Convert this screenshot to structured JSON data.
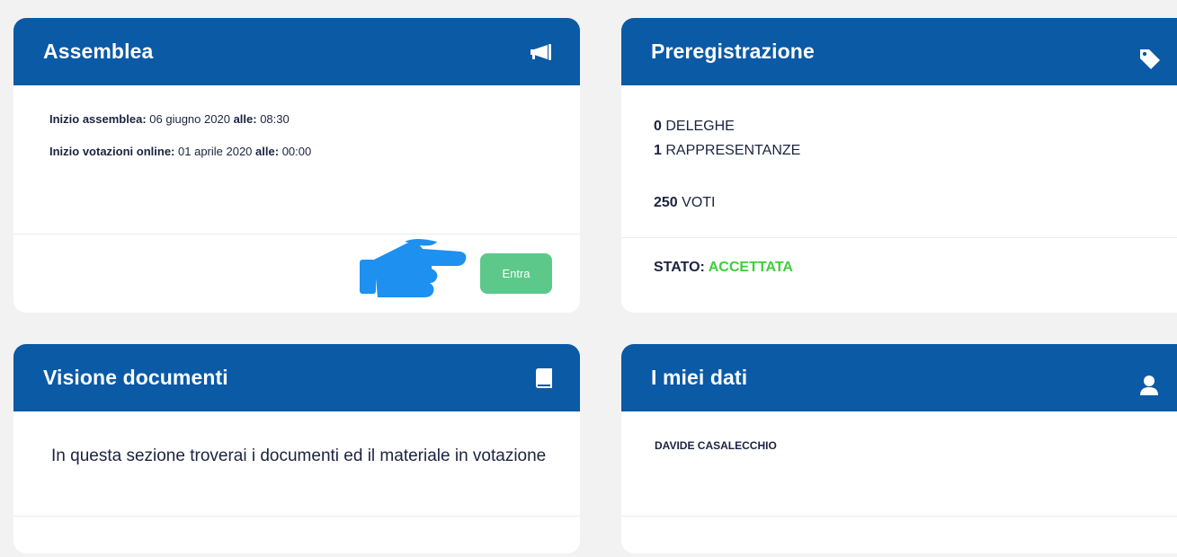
{
  "colors": {
    "header": "#0a5aa6",
    "button": "#5cc98a",
    "stato_ok": "#3ecf3a",
    "hand": "#1e90f0"
  },
  "assemblea": {
    "title": "Assemblea",
    "icon": "megaphone-icon",
    "inizio_label": "Inizio assemblea:",
    "inizio_date": "06 giugno 2020",
    "alle_label": "alle:",
    "inizio_time": "08:30",
    "votazioni_label": "Inizio votazioni online:",
    "votazioni_date": "01 aprile 2020",
    "votazioni_time": "00:00",
    "button": "Entra",
    "pointer_icon": "pointing-hand-icon"
  },
  "preregistrazione": {
    "title": "Preregistrazione",
    "icon": "tag-icon",
    "deleghe_count": "0",
    "deleghe_label": "DELEGHE",
    "rappresentanze_count": "1",
    "rappresentanze_label": "RAPPRESENTANZE",
    "voti_count": "250",
    "voti_label": "VOTI",
    "stato_label": "STATO:",
    "stato_value": "ACCETTATA"
  },
  "visione": {
    "title": "Visione documenti",
    "icon": "book-icon",
    "text": "In questa sezione troverai i documenti ed il materiale in votazione"
  },
  "dati": {
    "title": "I miei dati",
    "icon": "user-icon",
    "name": "DAVIDE CASALECCHIO"
  }
}
